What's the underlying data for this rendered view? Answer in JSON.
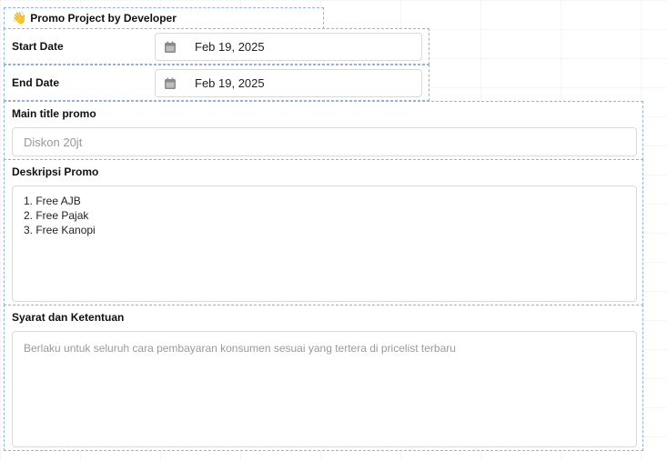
{
  "header": {
    "icon": "waving-hand-icon",
    "emoji": "👋",
    "title": "Promo Project by Developer"
  },
  "start_date": {
    "label": "Start Date",
    "icon": "calendar-icon",
    "value": "Feb 19, 2025"
  },
  "end_date": {
    "label": "End Date",
    "icon": "calendar-icon",
    "value": "Feb 19, 2025"
  },
  "main_title": {
    "label": "Main title promo",
    "placeholder": "Diskon 20jt"
  },
  "description": {
    "label": "Deskripsi Promo",
    "lines": [
      "1. Free AJB",
      "2. Free Pajak",
      "3. Free Kanopi"
    ]
  },
  "terms": {
    "label": "Syarat dan Ketentuan",
    "placeholder": "Berlaku untuk seluruh cara pembayaran konsumen sesuai yang tertera di pricelist terbaru"
  },
  "colors": {
    "dashed_border": "#8fb2ef",
    "field_border": "#d9d9d9",
    "placeholder_text": "#9a9a9a",
    "icon_gray": "#8a8a8a"
  }
}
